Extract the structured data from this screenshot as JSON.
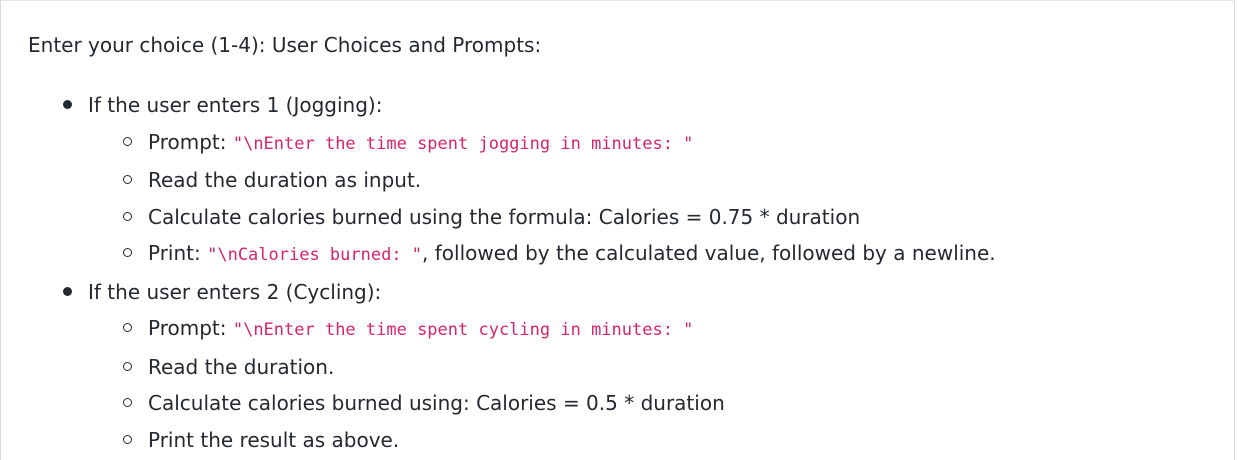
{
  "intro": "Enter your choice (1-4): User Choices and Prompts:",
  "items": [
    {
      "label": "If the user enters 1 (Jogging):",
      "subitems": {
        "prompt_prefix": "Prompt: ",
        "prompt_code": "\"\\nEnter the time spent jogging in minutes: \"",
        "read": "Read the duration as input.",
        "calc": "Calculate calories burned using the formula: Calories = 0.75 * duration",
        "print_prefix": "Print: ",
        "print_code": "\"\\nCalories burned: \"",
        "print_suffix": ", followed by the calculated value, followed by a newline."
      }
    },
    {
      "label": "If the user enters 2 (Cycling):",
      "subitems": {
        "prompt_prefix": "Prompt: ",
        "prompt_code": "\"\\nEnter the time spent cycling in minutes: \"",
        "read": "Read the duration.",
        "calc": "Calculate calories burned using: Calories = 0.5 * duration",
        "print": "Print the result as above."
      }
    }
  ],
  "colors": {
    "text": "#24292f",
    "code": "#d6246e"
  }
}
